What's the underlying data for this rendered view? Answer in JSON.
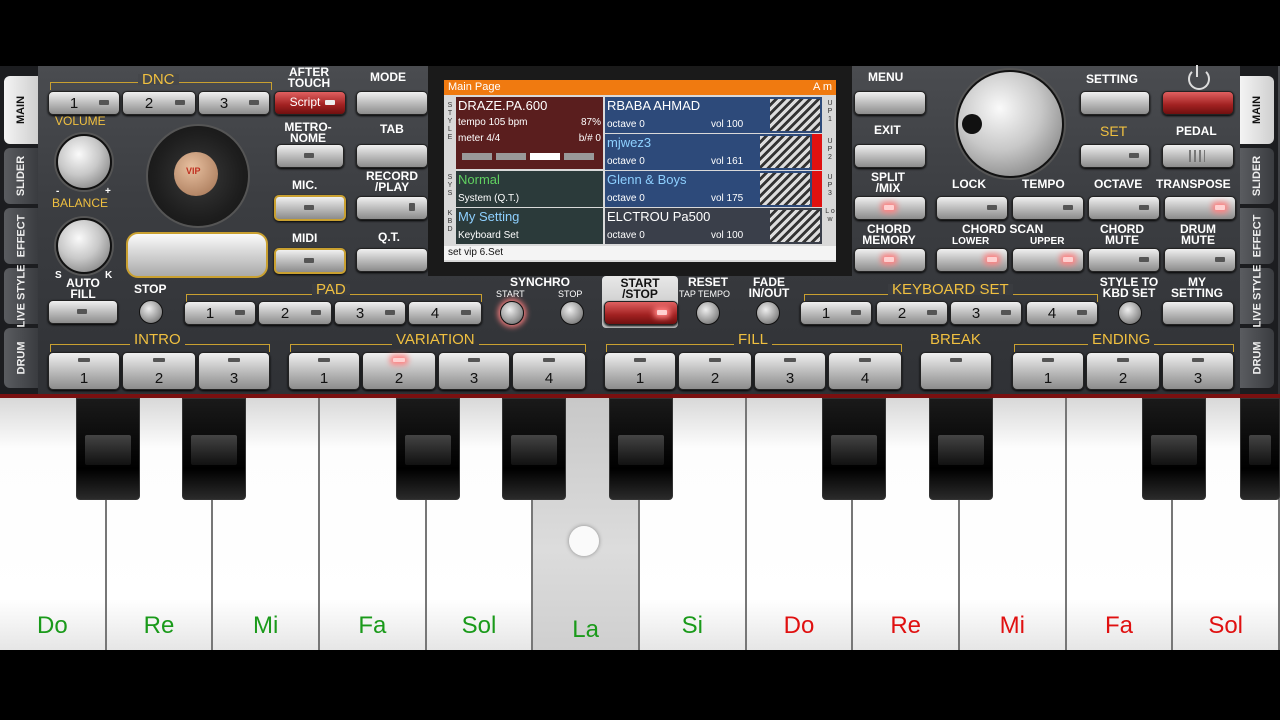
{
  "left_tabs": [
    "MAIN",
    "SLIDER",
    "EFFECT",
    "LIVE STYLE",
    "DRUM"
  ],
  "right_tabs": [
    "MAIN",
    "SLIDER",
    "EFFECT",
    "LIVE STYLE",
    "DRUM"
  ],
  "dnc": {
    "label": "DNC",
    "buttons": [
      "1",
      "2",
      "3"
    ],
    "script": "Script"
  },
  "after_touch": "AFTER TOUCH",
  "volume": "VOLUME",
  "balance": "BALANCE",
  "minus": "-",
  "plus": "+",
  "s": "S",
  "k": "K",
  "metronome": "METRO- NOME",
  "mic": "MIC.",
  "midi": "MIDI",
  "auto_fill": "AUTO FILL",
  "vip": "VIP",
  "mode": "MODE",
  "tab": "TAB",
  "record_play": "RECORD /PLAY",
  "qt": "Q.T.",
  "menu": "MENU",
  "exit": "EXIT",
  "split_mix": "SPLIT /MIX",
  "chord_memory": "CHORD MEMORY",
  "setting": "SETTING",
  "set": "SET",
  "pedal": "PEDAL",
  "lock": "LOCK",
  "tempo": "TEMPO",
  "octave": "OCTAVE",
  "transpose": "TRANSPOSE",
  "chord_scan": "CHORD SCAN",
  "lower": "LOWER",
  "upper": "UPPER",
  "chord_mute": "CHORD MUTE",
  "drum_mute": "DRUM MUTE",
  "stop": "STOP",
  "pad": "PAD",
  "pad_buttons": [
    "1",
    "2",
    "3",
    "4"
  ],
  "synchro": "SYNCHRO",
  "synchro_start": "START",
  "synchro_stop": "STOP",
  "start_stop": "START /STOP",
  "reset": "RESET",
  "tap_tempo": "TAP TEMPO",
  "fade": "FADE IN/OUT",
  "keyboard_set": "KEYBOARD SET",
  "kbd_buttons": [
    "1",
    "2",
    "3",
    "4"
  ],
  "style_to_kbd": "STYLE TO KBD SET",
  "my_setting": "MY SETTING",
  "intro": "INTRO",
  "intro_buttons": [
    "1",
    "2",
    "3"
  ],
  "variation": "VARIATION",
  "variation_buttons": [
    "1",
    "2",
    "3",
    "4"
  ],
  "fill": "FILL",
  "fill_buttons": [
    "1",
    "2",
    "3",
    "4"
  ],
  "break": "BREAK",
  "ending": "ENDING",
  "ending_buttons": [
    "1",
    "2",
    "3"
  ],
  "screen": {
    "header": "Main Page",
    "chord": "A m",
    "style_name": "DRAZE.PA.600",
    "tempo": "tempo 105 bpm",
    "percent": "87%",
    "meter": "meter 4/4",
    "bsharp": "b/# 0",
    "up1": {
      "name": "RBABA AHMAD",
      "octave": "octave 0",
      "vol": "vol 100"
    },
    "up2": {
      "name": "mjwez3",
      "octave": "octave 0",
      "vol": "vol 161"
    },
    "up3": {
      "name": "Glenn & Boys",
      "octave": "octave 0",
      "vol": "vol 175"
    },
    "low": {
      "name": "ELCTROU Pa500",
      "octave": "octave 0",
      "vol": "vol 100"
    },
    "sys_name": "Normal",
    "sys_sub": "System (Q.T.)",
    "kbd_name": "My Setting",
    "kbd_sub": "Keyboard Set",
    "footer": "set vip 6.Set",
    "side_style": "S T Y L E",
    "side_sys": "S Y S",
    "side_kbd": "K B D",
    "side_up1": "U P 1",
    "side_up2": "U P 2",
    "side_up3": "U P 3",
    "side_low": "L o w"
  },
  "keys": [
    {
      "note": "Do",
      "color": "#1a9a1a"
    },
    {
      "note": "Re",
      "color": "#1a9a1a"
    },
    {
      "note": "Mi",
      "color": "#1a9a1a"
    },
    {
      "note": "Fa",
      "color": "#1a9a1a"
    },
    {
      "note": "Sol",
      "color": "#1a9a1a"
    },
    {
      "note": "La",
      "color": "#1a9a1a"
    },
    {
      "note": "Si",
      "color": "#1a9a1a"
    },
    {
      "note": "Do",
      "color": "#e01010"
    },
    {
      "note": "Re",
      "color": "#e01010"
    },
    {
      "note": "Mi",
      "color": "#e01010"
    },
    {
      "note": "Fa",
      "color": "#e01010"
    },
    {
      "note": "Sol",
      "color": "#e01010"
    }
  ]
}
